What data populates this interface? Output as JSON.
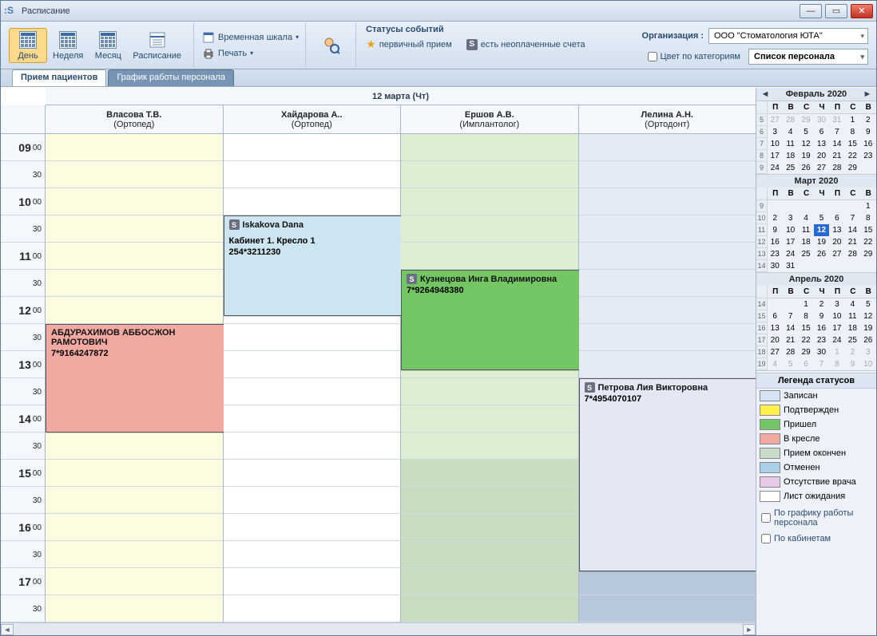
{
  "window": {
    "title": "Расписание"
  },
  "ribbon": {
    "day": "День",
    "week": "Неделя",
    "month": "Месяц",
    "schedule": "Расписание",
    "timescale": "Временная шкала",
    "print": "Печать",
    "status_title": "Статусы событий",
    "status_primary": "первичный прием",
    "status_unpaid": "есть неоплаченные счета",
    "org_label": "Организация :",
    "org_value": "ООО \"Стоматология ЮТА\"",
    "color_by_cat": "Цвет по категориям",
    "staff_list": "Список персонала"
  },
  "tabs": {
    "t1": "Прием пациентов",
    "t2": "График работы персонала"
  },
  "date_header": "12 марта (Чт)",
  "doctors": [
    {
      "name": "Власова Т.В.",
      "role": "(Ортопед)"
    },
    {
      "name": "Хайдарова А..",
      "role": "(Ортопед)"
    },
    {
      "name": "Ершов А.В.",
      "role": "(Имплантолог)"
    },
    {
      "name": "Лелина А.Н.",
      "role": "(Ортодонт)"
    }
  ],
  "appointments": {
    "a0": {
      "name": "АБДУРАХИМОВ АББОСЖОН РАМОТОВИЧ",
      "phone": "7*9164247872"
    },
    "a1": {
      "name": "Iskakova Dana",
      "room": "Кабинет 1. Кресло 1",
      "phone": "254*3211230"
    },
    "a2": {
      "name": "Кузнецова Инга Владимировна",
      "phone": "7*9264948380"
    },
    "a3": {
      "name": "Петрова Лия Викторовна",
      "phone": "7*4954070107"
    }
  },
  "months": {
    "feb": "Февраль 2020",
    "mar": "Март 2020",
    "apr": "Апрель 2020"
  },
  "dayheaders": [
    "П",
    "В",
    "С",
    "Ч",
    "П",
    "С",
    "В"
  ],
  "legend": {
    "title": "Легенда статусов",
    "items": [
      {
        "label": "Записан",
        "color": "#d4e3f4"
      },
      {
        "label": "Подтвержден",
        "color": "#fff04a"
      },
      {
        "label": "Пришел",
        "color": "#74c665"
      },
      {
        "label": "В кресле",
        "color": "#f2a9a2"
      },
      {
        "label": "Прием окончен",
        "color": "#c8dccc"
      },
      {
        "label": "Отменен",
        "color": "#a8d0e8"
      },
      {
        "label": "Отсутствие врача",
        "color": "#e8c8e8"
      },
      {
        "label": "Лист ожидания",
        "color": "#ffffff"
      }
    ]
  },
  "sideopts": {
    "bysched": "По графику работы персонала",
    "byroom": "По кабинетам"
  }
}
